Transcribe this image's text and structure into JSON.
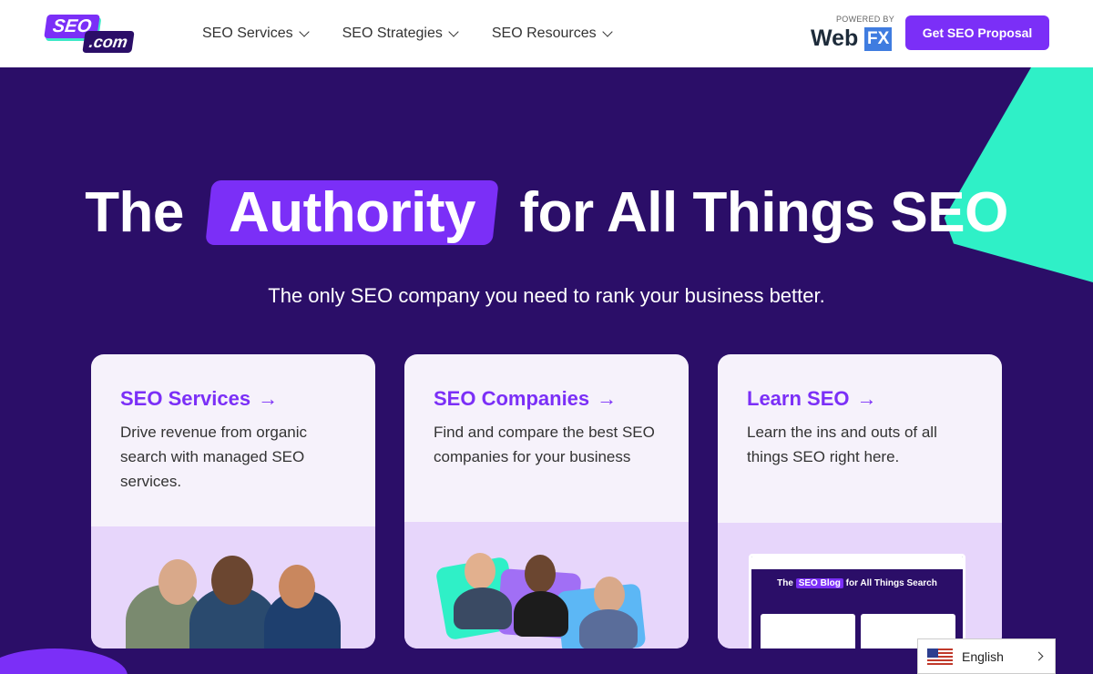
{
  "header": {
    "logo_main": "SEO",
    "logo_sub": ".com",
    "nav": [
      {
        "label": "SEO Services"
      },
      {
        "label": "SEO Strategies"
      },
      {
        "label": "SEO Resources"
      }
    ],
    "powered_label": "POWERED BY",
    "powered_brand_a": "Web",
    "powered_brand_b": "FX",
    "cta_label": "Get SEO Proposal"
  },
  "hero": {
    "headline_before": "The",
    "headline_highlight": "Authority",
    "headline_after": "for All Things SEO",
    "subhead": "The only SEO company you need to rank your business better."
  },
  "cards": [
    {
      "title": "SEO Services",
      "arrow": "→",
      "desc": "Drive revenue from organic search with managed SEO services."
    },
    {
      "title": "SEO Companies",
      "arrow": "→",
      "desc": "Find and compare the best SEO companies for your business"
    },
    {
      "title": "Learn SEO",
      "arrow": "→",
      "desc": "Learn the ins and outs of all things SEO right here."
    }
  ],
  "blog_preview": {
    "title_before": "The",
    "title_highlight": "SEO Blog",
    "title_after": "for All Things Search"
  },
  "language": {
    "label": "English"
  },
  "colors": {
    "brand": "#7b2ff7",
    "navy": "#2b0e68",
    "teal": "#2ff0c7",
    "card_bottom": "#e7d6fb"
  }
}
